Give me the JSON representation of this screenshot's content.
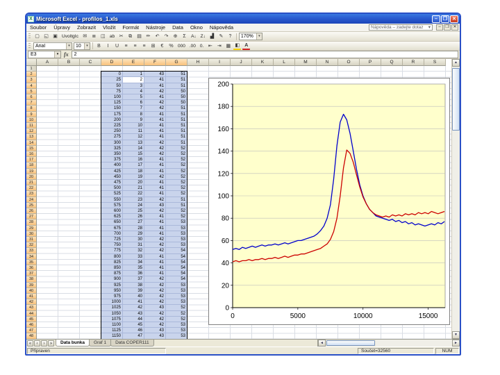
{
  "window": {
    "title": "Microsoft Excel - profilos_1.xls",
    "controls": {
      "minimize": "–",
      "maximize": "❐",
      "close": "✕"
    }
  },
  "menu": {
    "items": [
      "Soubor",
      "Úpravy",
      "Zobrazit",
      "Vložit",
      "Formát",
      "Nástroje",
      "Data",
      "Okno",
      "Nápověda"
    ],
    "question_box": "Nápověda – zadejte dotaz",
    "workbook_controls": [
      "–",
      "❐",
      "✕"
    ]
  },
  "toolbar": {
    "zoom": "170%",
    "buttons": [
      {
        "name": "new-icon",
        "glyph": "▢"
      },
      {
        "name": "open-icon",
        "glyph": "◱"
      },
      {
        "name": "save-icon",
        "glyph": "▣"
      },
      {
        "name": "custom-button",
        "glyph": "UvoItgIc",
        "text": true
      },
      {
        "name": "email-icon",
        "glyph": "✉"
      },
      {
        "name": "print-icon",
        "glyph": "≣"
      },
      {
        "name": "print-preview-icon",
        "glyph": "◫"
      },
      {
        "name": "spelling-icon",
        "glyph": "ab",
        "text": true
      },
      {
        "name": "cut-icon",
        "glyph": "✂"
      },
      {
        "name": "copy-icon",
        "glyph": "⧉"
      },
      {
        "name": "paste-icon",
        "glyph": "▤"
      },
      {
        "name": "format-painter-icon",
        "glyph": "✏"
      },
      {
        "name": "undo-icon",
        "glyph": "↶"
      },
      {
        "name": "redo-icon",
        "glyph": "↷"
      },
      {
        "name": "hyperlink-icon",
        "glyph": "⊕"
      },
      {
        "name": "autosum-icon",
        "glyph": "Σ"
      },
      {
        "name": "sort-asc-icon",
        "glyph": "A↓",
        "text": true
      },
      {
        "name": "sort-desc-icon",
        "glyph": "Z↓",
        "text": true
      },
      {
        "name": "chart-wizard-icon",
        "glyph": "▟"
      },
      {
        "name": "drawing-icon",
        "glyph": "✎"
      },
      {
        "name": "help-icon",
        "glyph": "?"
      }
    ]
  },
  "formatting": {
    "font": "Arial",
    "size": "10",
    "buttons": [
      {
        "name": "bold-button",
        "glyph": "B"
      },
      {
        "name": "italic-button",
        "glyph": "I"
      },
      {
        "name": "underline-button",
        "glyph": "U"
      },
      {
        "name": "align-left-button",
        "glyph": "≡"
      },
      {
        "name": "align-center-button",
        "glyph": "≡"
      },
      {
        "name": "align-right-button",
        "glyph": "≡"
      },
      {
        "name": "merge-center-button",
        "glyph": "⊞"
      },
      {
        "name": "currency-button",
        "glyph": "€"
      },
      {
        "name": "percent-button",
        "glyph": "%"
      },
      {
        "name": "comma-button",
        "glyph": "000",
        "text": true
      },
      {
        "name": "increase-decimal-button",
        "glyph": ".00",
        "text": true
      },
      {
        "name": "decrease-decimal-button",
        "glyph": "0.",
        "text": true
      },
      {
        "name": "decrease-indent-button",
        "glyph": "⇤"
      },
      {
        "name": "increase-indent-button",
        "glyph": "⇥"
      },
      {
        "name": "borders-button",
        "glyph": "▦"
      },
      {
        "name": "fill-color-button",
        "glyph": "◧",
        "cls": "bc"
      },
      {
        "name": "font-color-button",
        "glyph": "A",
        "cls": "fc"
      }
    ]
  },
  "formula_bar": {
    "name_box": "E3",
    "value": "2"
  },
  "grid": {
    "columns": [
      "A",
      "B",
      "C",
      "D",
      "E",
      "F",
      "G",
      "H",
      "I",
      "J",
      "K",
      "L",
      "M",
      "N",
      "O",
      "P",
      "Q",
      "R",
      "S"
    ],
    "selected_columns": [
      "D",
      "E",
      "F",
      "G"
    ],
    "row_count": 48,
    "data_start_row": 2,
    "active_cell": "E3",
    "rows": [
      [
        0,
        1,
        43,
        51
      ],
      [
        25,
        2,
        41,
        51
      ],
      [
        50,
        3,
        41,
        51
      ],
      [
        75,
        4,
        42,
        50
      ],
      [
        100,
        5,
        41,
        50
      ],
      [
        125,
        6,
        42,
        50
      ],
      [
        150,
        7,
        42,
        51
      ],
      [
        175,
        8,
        41,
        51
      ],
      [
        200,
        9,
        41,
        51
      ],
      [
        225,
        10,
        41,
        51
      ],
      [
        250,
        11,
        41,
        51
      ],
      [
        275,
        12,
        41,
        51
      ],
      [
        300,
        13,
        42,
        51
      ],
      [
        325,
        14,
        42,
        52
      ],
      [
        350,
        15,
        42,
        52
      ],
      [
        375,
        16,
        41,
        52
      ],
      [
        400,
        17,
        41,
        52
      ],
      [
        425,
        18,
        41,
        52
      ],
      [
        450,
        19,
        42,
        52
      ],
      [
        475,
        20,
        41,
        52
      ],
      [
        500,
        21,
        41,
        52
      ],
      [
        525,
        22,
        41,
        52
      ],
      [
        550,
        23,
        42,
        51
      ],
      [
        575,
        24,
        43,
        51
      ],
      [
        600,
        25,
        42,
        52
      ],
      [
        625,
        26,
        41,
        52
      ],
      [
        650,
        27,
        41,
        53
      ],
      [
        675,
        28,
        41,
        53
      ],
      [
        700,
        29,
        41,
        53
      ],
      [
        725,
        30,
        42,
        53
      ],
      [
        750,
        31,
        42,
        53
      ],
      [
        775,
        32,
        42,
        54
      ],
      [
        800,
        33,
        41,
        54
      ],
      [
        825,
        34,
        41,
        54
      ],
      [
        850,
        35,
        41,
        54
      ],
      [
        875,
        36,
        41,
        54
      ],
      [
        900,
        37,
        42,
        54
      ],
      [
        925,
        38,
        42,
        53
      ],
      [
        950,
        39,
        42,
        53
      ],
      [
        975,
        40,
        42,
        53
      ],
      [
        1000,
        41,
        42,
        53
      ],
      [
        1025,
        42,
        43,
        52
      ],
      [
        1050,
        43,
        42,
        52
      ],
      [
        1075,
        44,
        42,
        52
      ],
      [
        1100,
        45,
        42,
        53
      ],
      [
        1125,
        46,
        43,
        53
      ],
      [
        1150,
        47,
        43,
        53
      ]
    ]
  },
  "chart_data": {
    "type": "line",
    "x_start": 0,
    "x_step": 250,
    "xmax": 16300,
    "xticks": [
      0,
      5000,
      10000,
      15000
    ],
    "ylim": [
      0,
      200
    ],
    "ytick": 20,
    "plot_bg": "#ffffcc",
    "grid_color": "#bdbdbd",
    "series": [
      {
        "name": "blue-profile",
        "color": "#0000cc",
        "values": [
          52,
          53,
          52,
          54,
          53,
          54,
          55,
          54,
          55,
          56,
          55,
          56,
          56,
          57,
          56,
          57,
          58,
          57,
          58,
          59,
          60,
          60,
          61,
          62,
          63,
          64,
          66,
          69,
          73,
          80,
          92,
          115,
          145,
          166,
          173,
          168,
          156,
          140,
          124,
          110,
          100,
          93,
          88,
          85,
          82,
          81,
          80,
          79,
          78,
          79,
          77,
          78,
          76,
          77,
          75,
          76,
          74,
          75,
          74,
          73,
          74,
          75,
          74,
          76,
          75,
          77
        ]
      },
      {
        "name": "red-profile",
        "color": "#cc0000",
        "values": [
          41,
          42,
          41,
          42,
          42,
          43,
          42,
          43,
          43,
          44,
          43,
          44,
          44,
          45,
          44,
          45,
          46,
          45,
          46,
          47,
          47,
          48,
          48,
          49,
          50,
          51,
          52,
          53,
          55,
          57,
          61,
          68,
          80,
          100,
          125,
          141,
          138,
          130,
          119,
          108,
          99,
          93,
          88,
          85,
          83,
          82,
          81,
          82,
          81,
          83,
          82,
          83,
          82,
          84,
          83,
          84,
          83,
          85,
          84,
          85,
          84,
          86,
          85,
          84,
          85,
          86
        ]
      }
    ]
  },
  "sheet_tabs": [
    {
      "label": "Data bunka",
      "active": true
    },
    {
      "label": "Graf 1",
      "active": false
    },
    {
      "label": "Data COPER111",
      "active": false
    }
  ],
  "tab_nav": [
    "«",
    "‹",
    "›",
    "»"
  ],
  "status_bar": {
    "mode": "Připraven",
    "sum": "Součet=32560",
    "indicator": "NUM"
  }
}
